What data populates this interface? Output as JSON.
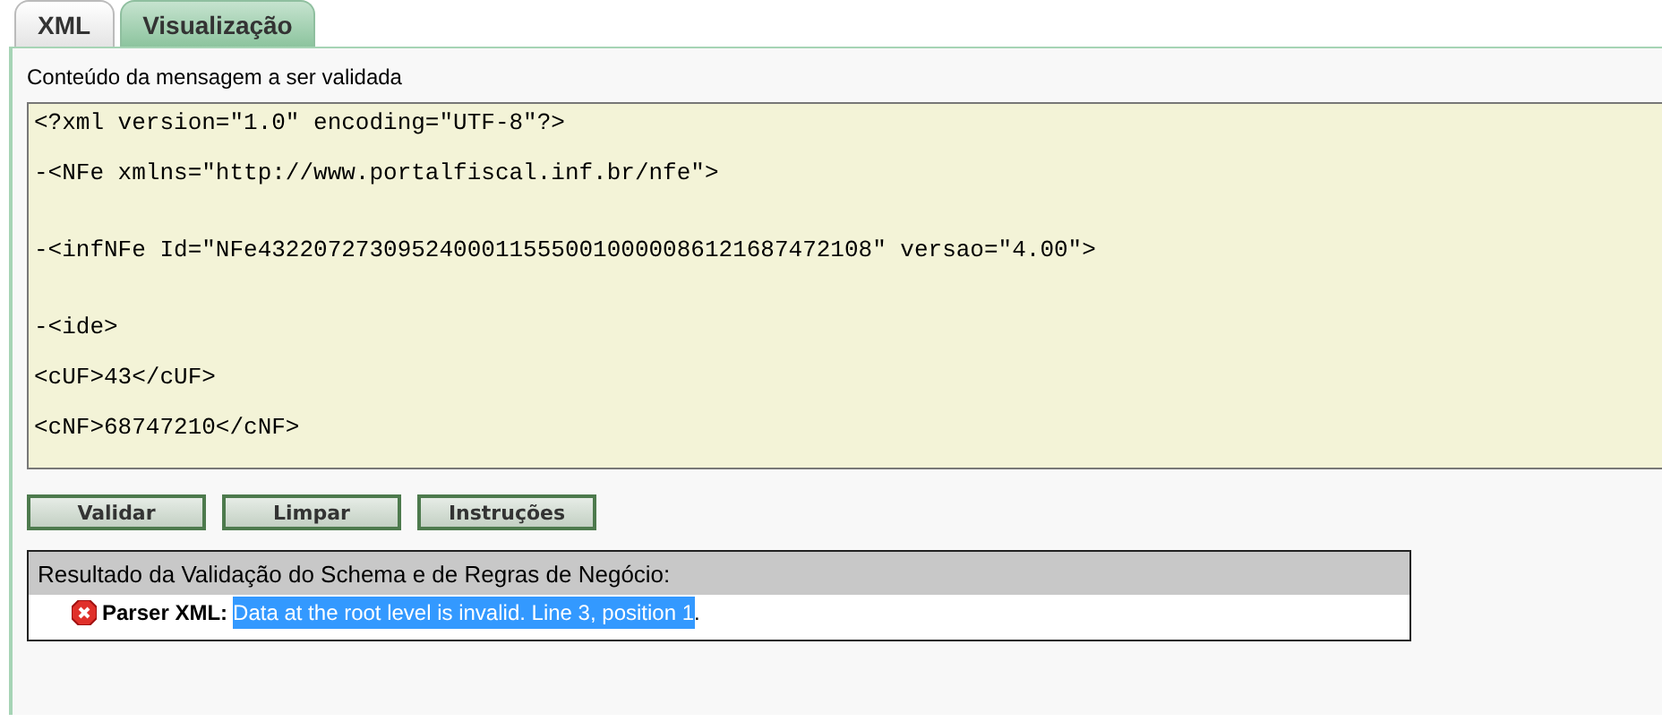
{
  "tabs": [
    {
      "label": "XML",
      "selected": false
    },
    {
      "label": "Visualização",
      "selected": true
    }
  ],
  "editor": {
    "label": "Conteúdo da mensagem a ser validada",
    "blocks": [
      {
        "lines": [
          "<?xml version=\"1.0\" encoding=\"UTF-8\"?>",
          "-<NFe xmlns=\"http://www.portalfiscal.inf.br/nfe\">"
        ]
      },
      {
        "lines": [
          "-<infNFe Id=\"NFe43220727309524000115550010000086121687472108\" versao=\"4.00\">"
        ]
      },
      {
        "lines": [
          "-<ide>",
          "<cUF>43</cUF>",
          "<cNF>68747210</cNF>"
        ]
      }
    ]
  },
  "buttons": [
    "Validar",
    "Limpar",
    "Instruções"
  ],
  "result": {
    "title": "Resultado da Validação do Schema e de Regras de Negócio:",
    "messages": [
      {
        "kind": "error",
        "label": "Parser XML:",
        "parts": [
          {
            "text": "Data at the root level is invalid. Line 3, position 1",
            "highlighted": true
          },
          {
            "text": ".",
            "highlighted": false
          }
        ]
      }
    ]
  }
}
